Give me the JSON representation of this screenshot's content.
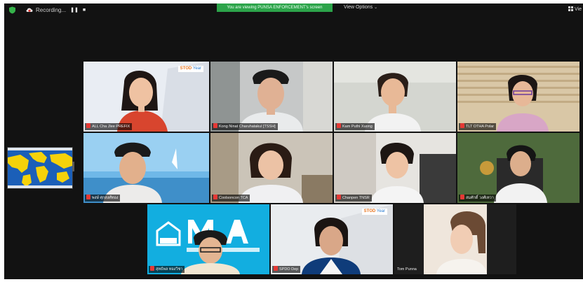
{
  "toolbar": {
    "recording_label": "Recording...",
    "pause_glyph": "❚❚",
    "stop_glyph": "■",
    "share_banner": "You are viewing PUNSA ENFORCEMENT's screen",
    "view_options": "View Options",
    "view_right": "Vie"
  },
  "participants": [
    {
      "name": "ALL Cha Jlee PREFIX"
    },
    {
      "name": "Kong Ninat Charuhatakul [TSSH]"
    },
    {
      "name": "Kam Puthi Xuong"
    },
    {
      "name": "TLT OTHA Polar"
    },
    {
      "name": "พงษ์ ศุกสงศ์ทอง"
    },
    {
      "name": "Coolsoncon TCA"
    },
    {
      "name": "Chanpen TNSR"
    },
    {
      "name": "สมศักดิ์ วงศ์เทวา"
    },
    {
      "name": "สุทธ์พล ทองวิชา"
    },
    {
      "name": "SPDO Dep"
    },
    {
      "name": "Tom Punna"
    }
  ],
  "badges": {
    "brand": "STOD",
    "year": "Year"
  },
  "colors": {
    "window_bg": "#121212",
    "share_green": "#2ca44a",
    "active_border": "#b9e83a",
    "mute_red": "#e53935",
    "slide_blue": "#12aee0"
  },
  "icons": [
    "shield-icon",
    "recording-cloud-icon",
    "pause-icon",
    "stop-icon",
    "chevron-down-icon",
    "grid-view-icon",
    "mute-icon"
  ]
}
